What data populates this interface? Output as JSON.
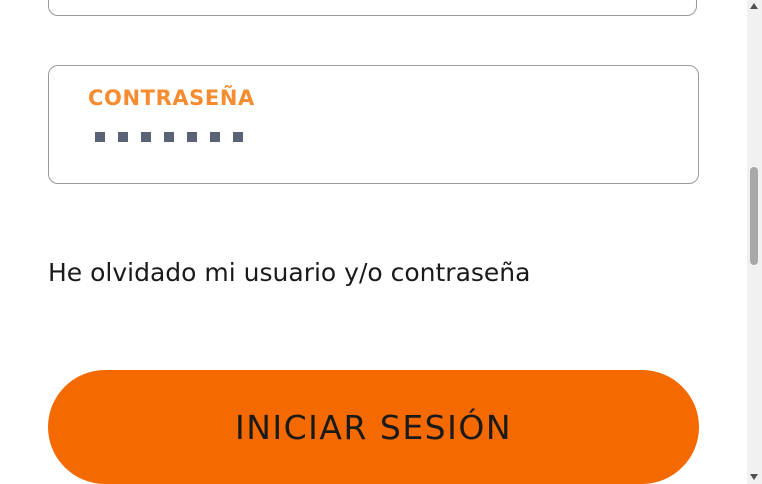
{
  "colors": {
    "accent": "#f56a00",
    "label": "#f68b2f",
    "dots": "#5a6375",
    "text": "#1a1a1a"
  },
  "password_field": {
    "label": "CONTRASEÑA",
    "masked_length": 7
  },
  "forgot_link": "He olvidado mi usuario y/o contraseña",
  "submit_button": "INICIAR SESIÓN",
  "icons": {
    "scroll_up": "scroll-up-arrow-icon",
    "scroll_down": "scroll-down-arrow-icon"
  }
}
